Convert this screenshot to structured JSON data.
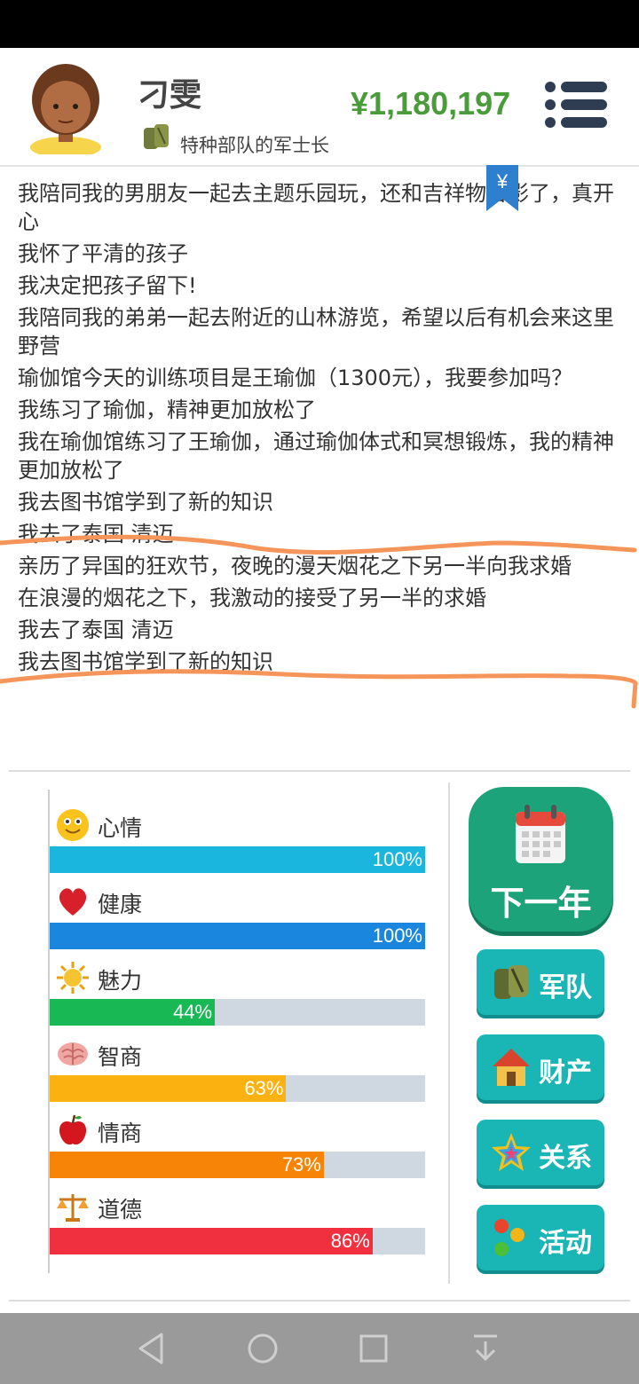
{
  "header": {
    "player_name": "刁雯",
    "rank": "特种部队的军士长",
    "money": "¥1,180,197",
    "bookmark_symbol": "¥"
  },
  "log": [
    {
      "text": "我陪同我的男朋友一起去主题乐园玩，还和吉祥物合影了，真开心"
    },
    {
      "text": "我怀了平清的孩子"
    },
    {
      "text": "我决定把孩子留下!"
    },
    {
      "text": "我陪同我的弟弟一起去附近的山林游览，希望以后有机会来这里野营"
    },
    {
      "text": "瑜伽馆今天的训练项目是王瑜伽（1300元），我要参加吗？"
    },
    {
      "text": "我练习了瑜伽，精神更加放松了"
    },
    {
      "text": "我在瑜伽馆练习了王瑜伽，通过瑜伽体式和冥想锻炼，我的精神更加放松了"
    },
    {
      "text": "我去图书馆学到了新的知识"
    },
    {
      "text": "我去了泰国 清迈"
    },
    {
      "text": "亲历了异国的狂欢节，夜晚的漫天烟花之下另一半向我求婚"
    },
    {
      "text": "在浪漫的烟花之下，我激动的接受了另一半的求婚"
    },
    {
      "text": "我去了泰国 清迈"
    },
    {
      "text": "我去图书馆学到了新的知识"
    }
  ],
  "stats": [
    {
      "label": "心情",
      "value": 100,
      "pct_text": "100%",
      "color": "#1bb6de",
      "icon": "smiley-icon"
    },
    {
      "label": "健康",
      "value": 100,
      "pct_text": "100%",
      "color": "#1b86dd",
      "icon": "heart-icon"
    },
    {
      "label": "魅力",
      "value": 44,
      "pct_text": "44%",
      "color": "#18b955",
      "icon": "sun-icon"
    },
    {
      "label": "智商",
      "value": 63,
      "pct_text": "63%",
      "color": "#fbb210",
      "icon": "brain-icon"
    },
    {
      "label": "情商",
      "value": 73,
      "pct_text": "73%",
      "color": "#f88407",
      "icon": "apple-icon"
    },
    {
      "label": "道德",
      "value": 86,
      "pct_text": "86%",
      "color": "#f0303f",
      "icon": "scales-icon"
    }
  ],
  "actions": {
    "next_year": "下一年",
    "army": "军队",
    "assets": "财产",
    "relations": "关系",
    "activities": "活动"
  },
  "colors": {
    "money": "#4a9b3a",
    "next_button": "#1da37a",
    "side_button": "#1ab5b5",
    "annotation_stroke": "#f5955a"
  }
}
